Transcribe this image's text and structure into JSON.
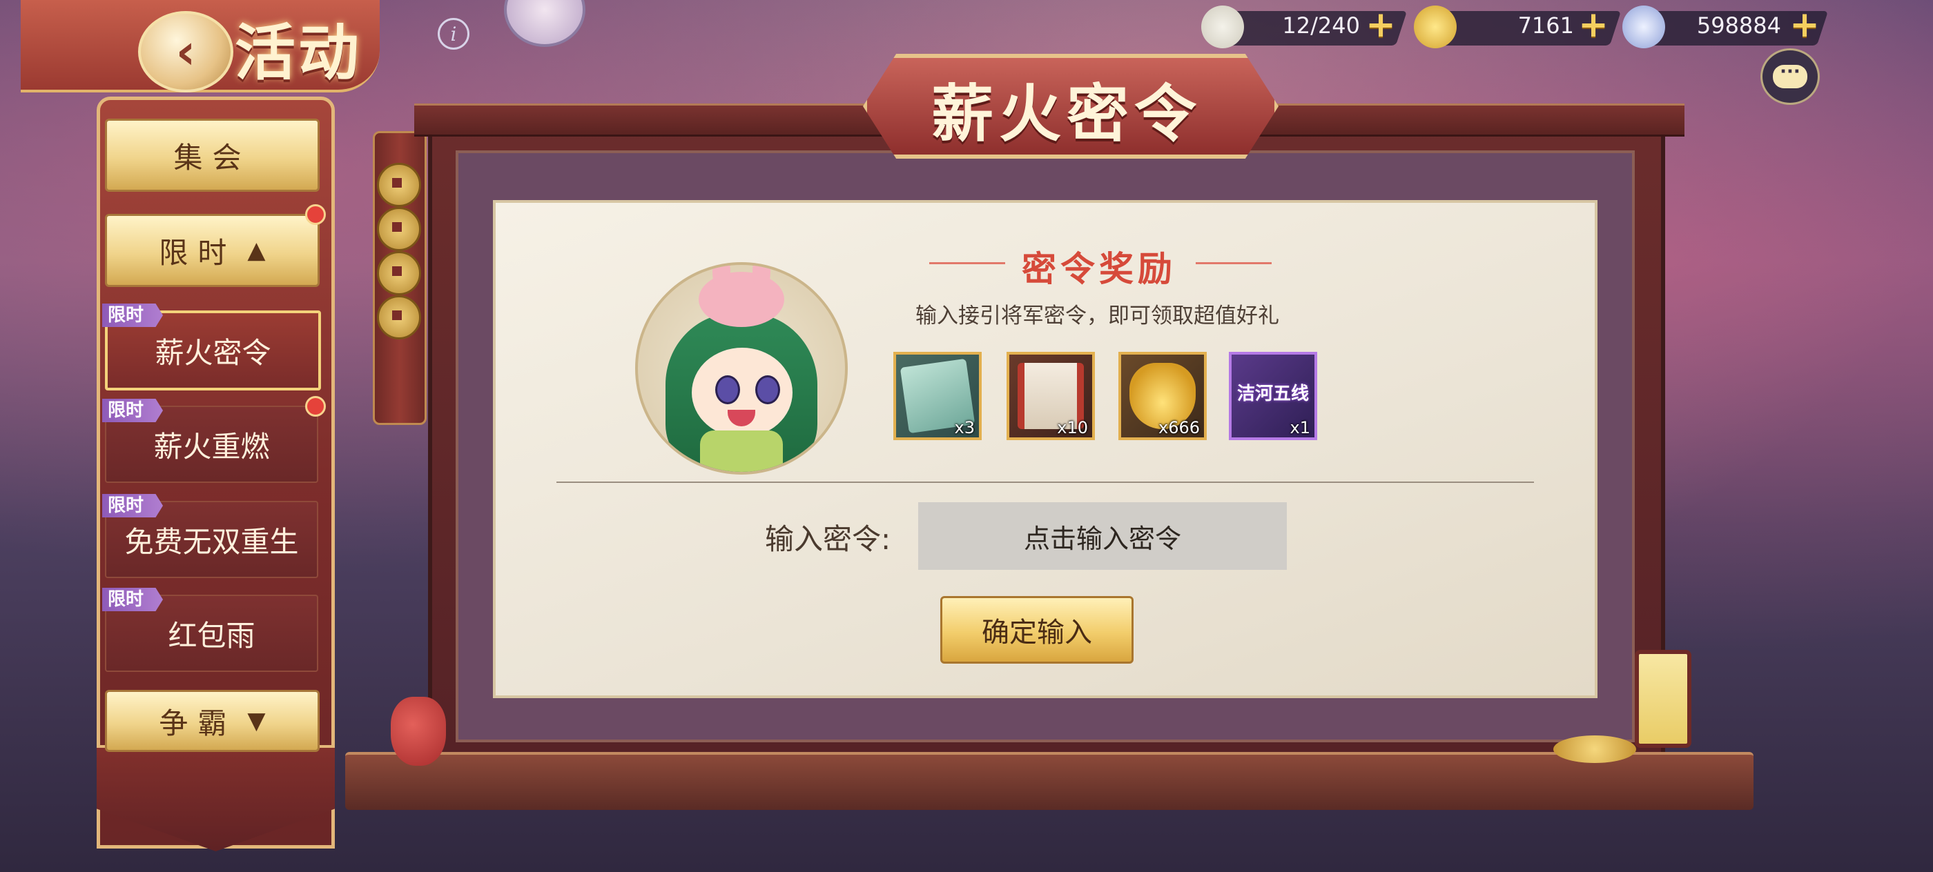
{
  "header": {
    "title": "活动",
    "back_icon": "back-arrow-icon",
    "info_icon": "info-icon"
  },
  "currencies": [
    {
      "name": "stamina",
      "icon": "bun-icon",
      "value": "12/240"
    },
    {
      "name": "gold",
      "icon": "gold-ingot-icon",
      "value": "7161"
    },
    {
      "name": "silver",
      "icon": "coin-icon",
      "value": "598884"
    }
  ],
  "sidebar": {
    "top_button": "集会",
    "section_limited": "限时",
    "items": [
      {
        "tag": "限时",
        "label": "薪火密令",
        "active": true
      },
      {
        "tag": "限时",
        "label": "薪火重燃",
        "active": false
      },
      {
        "tag": "限时",
        "label": "免费无双重生",
        "active": false
      },
      {
        "tag": "限时",
        "label": "红包雨",
        "active": false
      }
    ],
    "bottom_button": "争霸"
  },
  "panel": {
    "title": "薪火密令",
    "reward_heading": "密令奖励",
    "subtitle": "输入接引将军密令，即可领取超值好礼",
    "rewards": [
      {
        "icon": "dragon-card-icon",
        "count": "x3"
      },
      {
        "icon": "scroll-icon",
        "count": "x10"
      },
      {
        "icon": "gold-ingot-icon",
        "count": "x666"
      },
      {
        "icon": "title-badge-icon",
        "label": "洁河五线",
        "count": "x1"
      }
    ],
    "input_label": "输入密令:",
    "input_placeholder": "点击输入密令",
    "confirm_button": "确定输入"
  },
  "colors": {
    "accent_red": "#d64a3a",
    "gold": "#f2cd6b",
    "frame": "#6b2d2c"
  }
}
